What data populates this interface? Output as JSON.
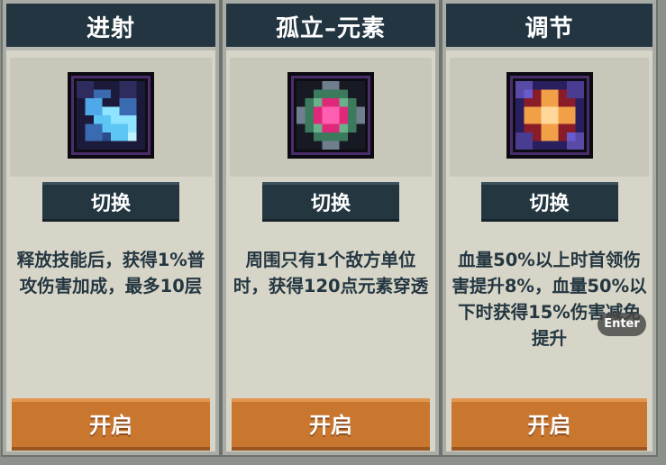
{
  "cards": [
    {
      "title": "进射",
      "icon": "ice-burst-icon",
      "switch_label": "切换",
      "description": "释放技能后，获得1%普攻伤害加成，最多10层",
      "enable_label": "开启"
    },
    {
      "title": "孤立–元素",
      "icon": "element-orb-icon",
      "switch_label": "切换",
      "description": "周围只有1个敌方单位时，获得120点元素穿透",
      "enable_label": "开启"
    },
    {
      "title": "调节",
      "icon": "radiant-star-icon",
      "switch_label": "切换",
      "description": "血量50%以上时首领伤害提升8%，血量50%以下时获得15%伤害减免提升",
      "enable_label": "开启"
    }
  ],
  "hint": {
    "key_label": "Enter"
  },
  "colors": {
    "header_bg": "#223540",
    "card_bg": "#d7d5c8",
    "button_dark": "#243741",
    "button_orange": "#c9772f"
  }
}
